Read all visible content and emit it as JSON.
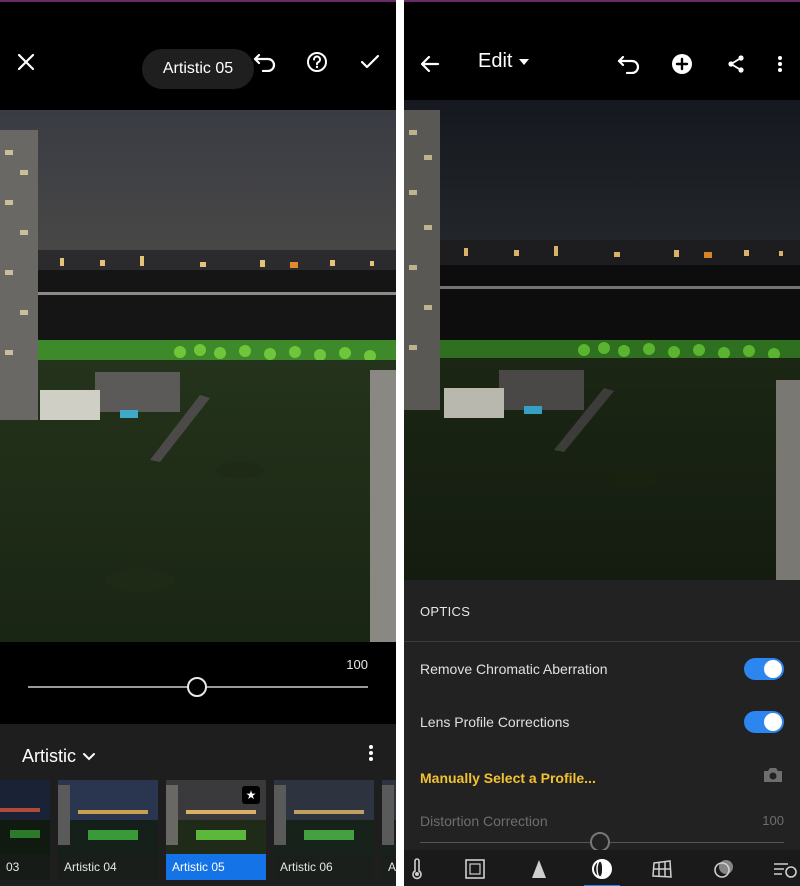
{
  "left": {
    "tooltip": "Artistic 05",
    "icons": [
      "close-icon",
      "undo-icon",
      "help-icon",
      "check-icon"
    ],
    "slider_value": "100",
    "slider_level": 1.0,
    "preset_group": "Artistic",
    "presets": [
      {
        "label": "03"
      },
      {
        "label": "Artistic 04"
      },
      {
        "label": "Artistic 05"
      },
      {
        "label": "Artistic 06"
      },
      {
        "label": "A"
      }
    ]
  },
  "right": {
    "title": "Edit",
    "icons": [
      "back-arrow-icon",
      "chevron-down-icon",
      "undo-icon",
      "add-icon",
      "share-icon",
      "more-icon"
    ],
    "optics": {
      "header": "OPTICS",
      "remove_ca_label": "Remove Chromatic Aberration",
      "remove_ca_on": true,
      "lens_profile_label": "Lens Profile Corrections",
      "lens_profile_on": true,
      "manual_profile_label": "Manually Select a Profile...",
      "distortion_label": "Distortion Correction",
      "distortion_value": "100"
    },
    "tools": [
      "thermometer-icon",
      "crop-icon",
      "detail-icon",
      "optics-icon",
      "geometry-icon",
      "effects-icon",
      "presets-icon"
    ]
  },
  "colors": {
    "accent": "#2d86f0",
    "selected": "#1473e6",
    "highlight": "#f2c230"
  }
}
